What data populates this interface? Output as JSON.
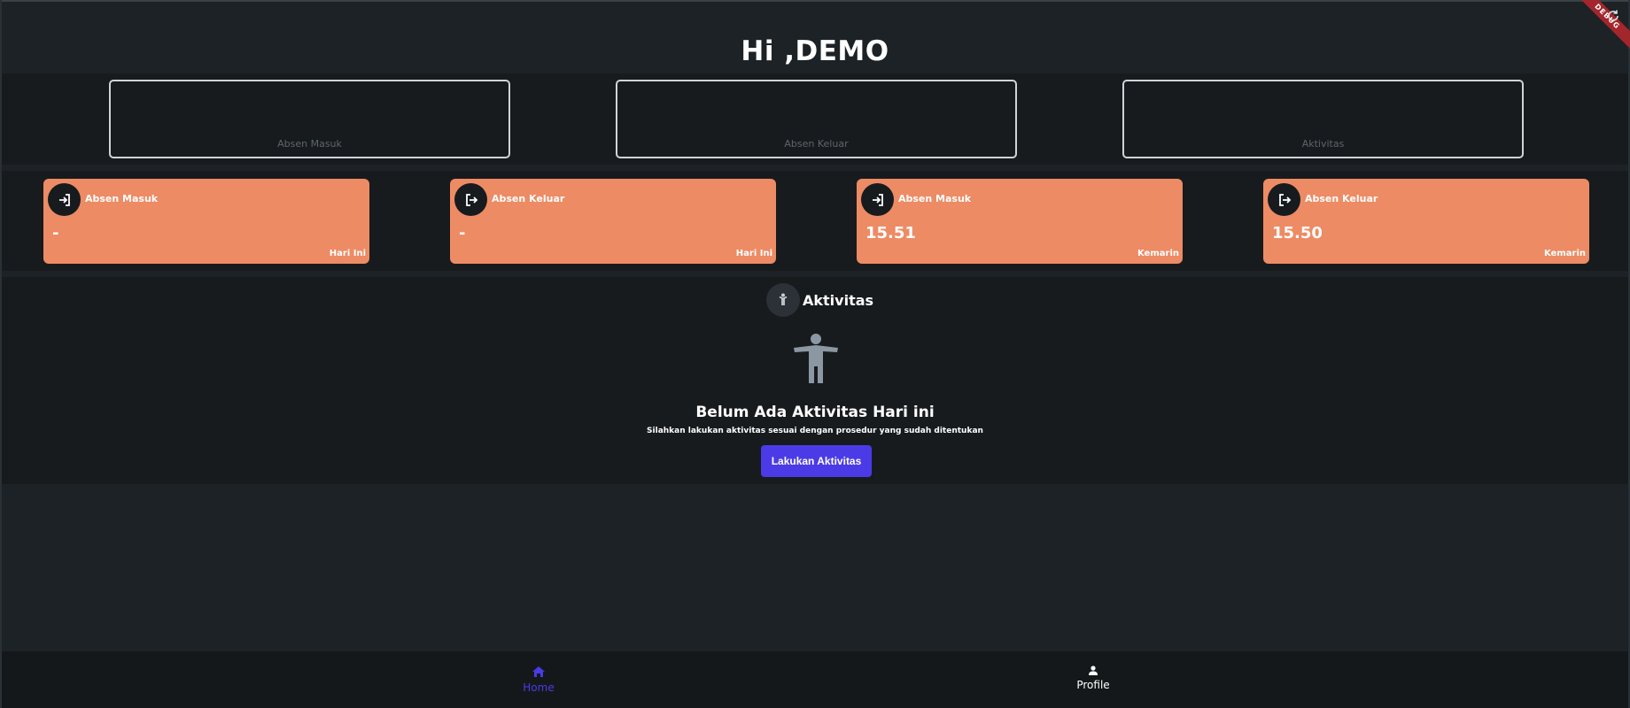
{
  "greeting": "Hi ,DEMO",
  "debug_banner": "DEBUG",
  "summary": [
    {
      "label": "Absen Masuk"
    },
    {
      "label": "Absen Keluar"
    },
    {
      "label": "Aktivitas"
    }
  ],
  "attendance_cards": [
    {
      "title": "Absen Masuk",
      "value": "-",
      "when": "Hari Ini",
      "icon": "login-icon"
    },
    {
      "title": "Absen Keluar",
      "value": "-",
      "when": "Hari Ini",
      "icon": "logout-icon"
    },
    {
      "title": "Absen Masuk",
      "value": "15.51",
      "when": "Kemarin",
      "icon": "login-icon"
    },
    {
      "title": "Absen Keluar",
      "value": "15.50",
      "when": "Kemarin",
      "icon": "logout-icon"
    }
  ],
  "activity": {
    "section_title": "Aktivitas",
    "empty_title": "Belum Ada Aktivitas Hari ini",
    "empty_subtitle": "Silahkan lakukan aktivitas sesuai dengan prosedur yang sudah ditentukan",
    "button_label": "Lakukan Aktivitas"
  },
  "bottom_nav": {
    "items": [
      {
        "label": "Home",
        "icon": "home-icon",
        "active": true
      },
      {
        "label": "Profile",
        "icon": "person-icon",
        "active": false
      }
    ]
  },
  "colors": {
    "background": "#1d2226",
    "panel": "#171b1e",
    "card_accent": "#ed8b64",
    "primary": "#4b3be6",
    "muted_text": "#5d666c"
  }
}
